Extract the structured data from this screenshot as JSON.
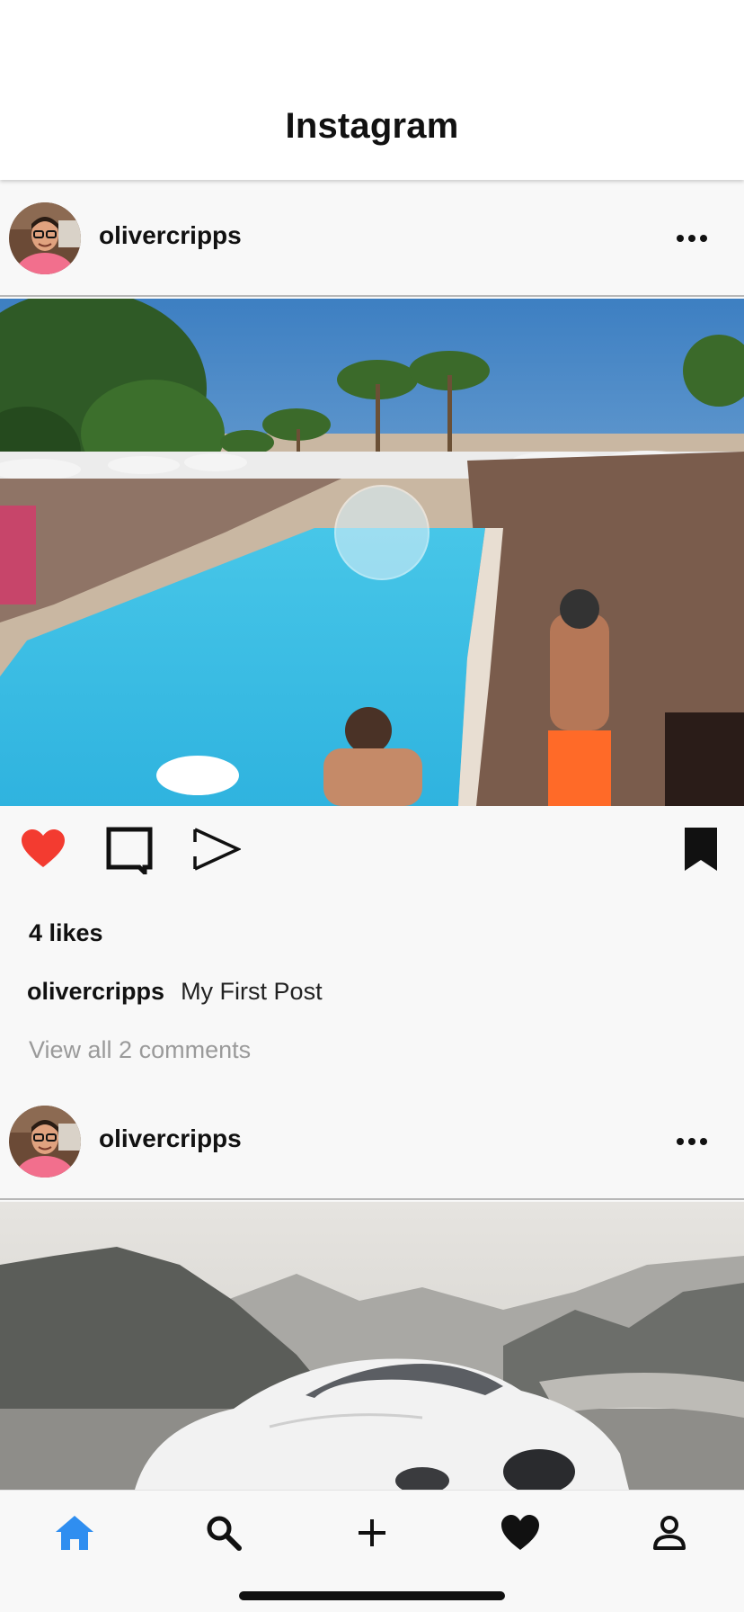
{
  "header": {
    "title": "Instagram"
  },
  "posts": [
    {
      "username": "olivercripps",
      "likes_text": "4 likes",
      "caption_user": "olivercripps",
      "caption_text": "My First Post",
      "view_comments": "View all 2 comments",
      "liked": true,
      "saved": true,
      "image_alt": "pool party photo"
    },
    {
      "username": "olivercripps",
      "image_alt": "white sports car in mountains"
    }
  ],
  "colors": {
    "like_red": "#f33b30",
    "tab_active_blue": "#2f8ef0",
    "icon_dark": "#111111",
    "muted_text": "#9a9a9a"
  },
  "icons": {
    "post_actions": [
      "heart-icon",
      "comment-icon",
      "share-icon",
      "bookmark-icon"
    ],
    "tabs": [
      "home-icon",
      "search-icon",
      "plus-icon",
      "heart-icon",
      "profile-icon"
    ]
  },
  "tabbar": {
    "active_tab": "home"
  }
}
